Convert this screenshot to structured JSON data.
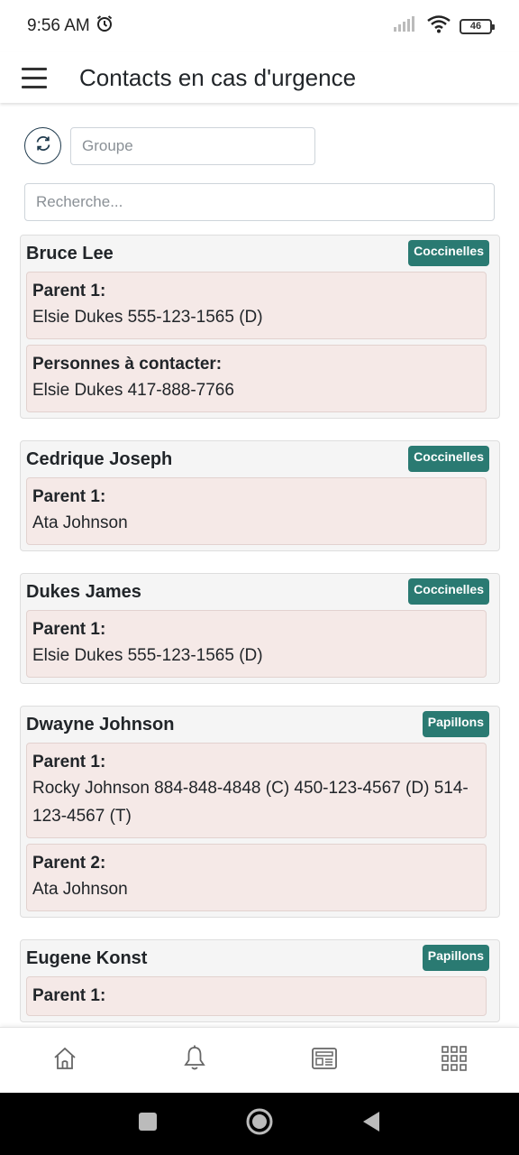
{
  "status_bar": {
    "time": "9:56 AM",
    "battery": "46",
    "icons": [
      "alarm-icon",
      "signal-icon",
      "wifi-icon",
      "battery-icon"
    ]
  },
  "app_bar": {
    "title": "Contacts en cas d'urgence",
    "menu_icon": "hamburger-menu-icon"
  },
  "filters": {
    "refresh_icon": "refresh-icon",
    "group_placeholder": "Groupe",
    "search_placeholder": "Recherche..."
  },
  "colors": {
    "badge": "#2a7a72",
    "card_bg": "#f5f5f5",
    "contact_bg": "#f5e9e7"
  },
  "students": [
    {
      "name": "Bruce Lee",
      "group": "Coccinelles",
      "contacts": [
        {
          "label": "Parent 1:",
          "value": "Elsie Dukes 555-123-1565 (D)"
        },
        {
          "label": "Personnes à contacter:",
          "value": "Elsie Dukes 417-888-7766"
        }
      ]
    },
    {
      "name": "Cedrique Joseph",
      "group": "Coccinelles",
      "contacts": [
        {
          "label": "Parent 1:",
          "value": "Ata Johnson"
        }
      ]
    },
    {
      "name": "Dukes James",
      "group": "Coccinelles",
      "contacts": [
        {
          "label": "Parent 1:",
          "value": "Elsie Dukes 555-123-1565 (D)"
        }
      ]
    },
    {
      "name": "Dwayne Johnson",
      "group": "Papillons",
      "contacts": [
        {
          "label": "Parent 1:",
          "value": "Rocky Johnson 884-848-4848 (C) 450-123-4567 (D) 514-123-4567 (T)"
        },
        {
          "label": "Parent 2:",
          "value": "Ata Johnson"
        }
      ]
    },
    {
      "name": "Eugene Konst",
      "group": "Papillons",
      "contacts": [
        {
          "label": "Parent 1:",
          "value": ""
        }
      ]
    }
  ],
  "bottom_nav": {
    "items": [
      "home-icon",
      "bell-icon",
      "newspaper-icon",
      "apps-grid-icon"
    ]
  },
  "system_nav": {
    "items": [
      "recents-icon",
      "home-circle-icon",
      "back-icon"
    ]
  }
}
